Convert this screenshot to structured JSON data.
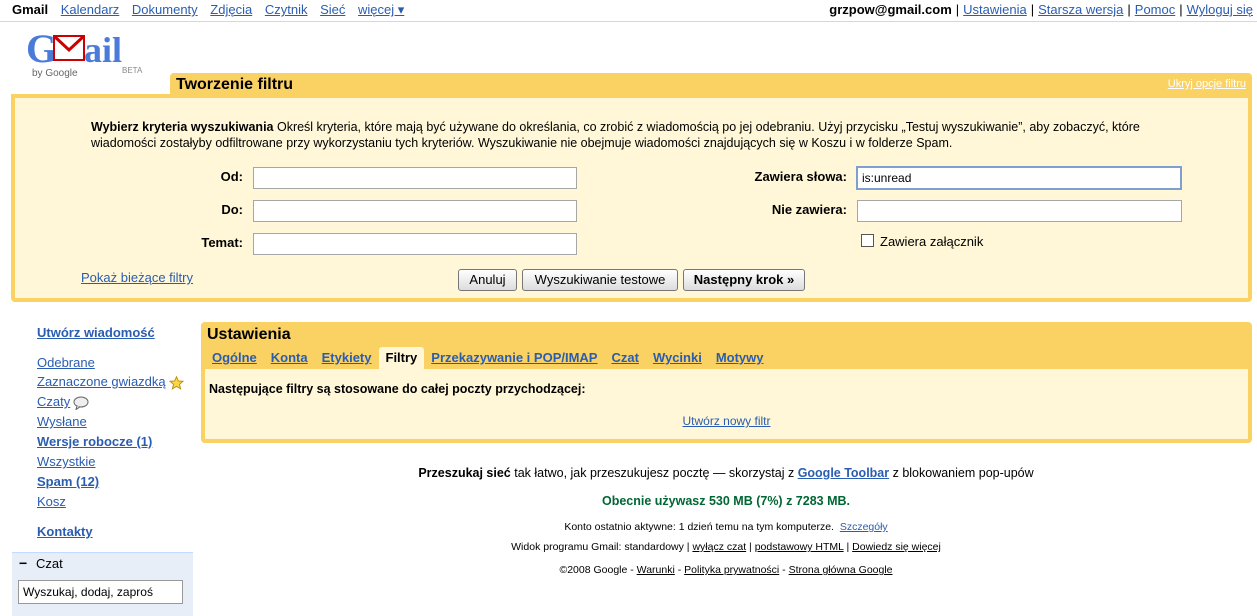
{
  "topnav": {
    "app": "Gmail",
    "links": [
      "Kalendarz",
      "Dokumenty",
      "Zdjęcia",
      "Czytnik",
      "Sieć",
      "więcej ▾"
    ]
  },
  "account": {
    "email": "grzpow@gmail.com",
    "links": [
      "Ustawienia",
      "Starsza wersja",
      "Pomoc",
      "Wyloguj się"
    ]
  },
  "logo": {
    "text": "Gmail",
    "by": "by Google",
    "beta": "BETA"
  },
  "filter": {
    "title": "Tworzenie filtru",
    "hide_link": "Ukryj opcje filtru",
    "criteria_bold": "Wybierz kryteria wyszukiwania",
    "criteria_text": " Określ kryteria, które mają być używane do określania, co zrobić z wiadomością po jej odebraniu. Użyj przycisku „Testuj wyszukiwanie”, aby zobaczyć, które wiadomości zostałyby odfiltrowane przy wykorzystaniu tych kryteriów. Wyszukiwanie nie obejmuje wiadomości znajdujących się w Koszu i w folderze Spam.",
    "from_label": "Od:",
    "from_value": "",
    "to_label": "Do:",
    "to_value": "",
    "subject_label": "Temat:",
    "subject_value": "",
    "has_words_label": "Zawiera słowa:",
    "has_words_value": "is:unread",
    "not_words_label": "Nie zawiera:",
    "not_words_value": "",
    "attachment_label": "Zawiera załącznik",
    "show_filters": "Pokaż bieżące filtry",
    "cancel": "Anuluj",
    "test_search": "Wyszukiwanie testowe",
    "next_step": "Następny krok »"
  },
  "sidebar": {
    "compose": "Utwórz wiadomość",
    "inbox": "Odebrane",
    "starred": "Zaznaczone gwiazdką",
    "chats": "Czaty",
    "sent": "Wysłane",
    "drafts": "Wersje robocze (1)",
    "all": "Wszystkie",
    "spam": "Spam (12)",
    "trash": "Kosz",
    "contacts": "Kontakty"
  },
  "chat": {
    "toggle": "−",
    "title": "Czat",
    "search_value": "Wyszukaj, dodaj, zaproś"
  },
  "settings": {
    "title": "Ustawienia",
    "tabs": [
      "Ogólne",
      "Konta",
      "Etykiety",
      "Filtry",
      "Przekazywanie i POP/IMAP",
      "Czat",
      "Wycinki",
      "Motywy"
    ],
    "active_tab": "Filtry",
    "description": "Następujące filtry są stosowane do całej poczty przychodzącej:",
    "new_filter": "Utwórz nowy filtr"
  },
  "footer": {
    "l1_bold": "Przeszukaj sieć",
    "l1_text": " tak łatwo, jak przeszukujesz pocztę — skorzystaj z ",
    "l1_link": "Google Toolbar",
    "l1_tail": " z blokowaniem pop-upów",
    "usage": "Obecnie używasz 530 MB (7%) z 7283 MB.",
    "activity": "Konto ostatnio aktywne: 1 dzień temu na tym komputerze.",
    "details": "Szczegóły",
    "view_text": "Widok programu Gmail: standardowy | ",
    "view_chat_off": "wyłącz czat",
    "view_basic": "podstawowy HTML",
    "view_more": "Dowiedz się więcej",
    "copyright": "©2008 Google - ",
    "terms": "Warunki",
    "privacy": "Polityka prywatności",
    "homepage": "Strona główna Google"
  },
  "colors": {
    "accent_yellow": "#fad163",
    "panel_cream": "#fff7d7",
    "link_blue": "#2a5db0",
    "usage_green": "#006633"
  }
}
